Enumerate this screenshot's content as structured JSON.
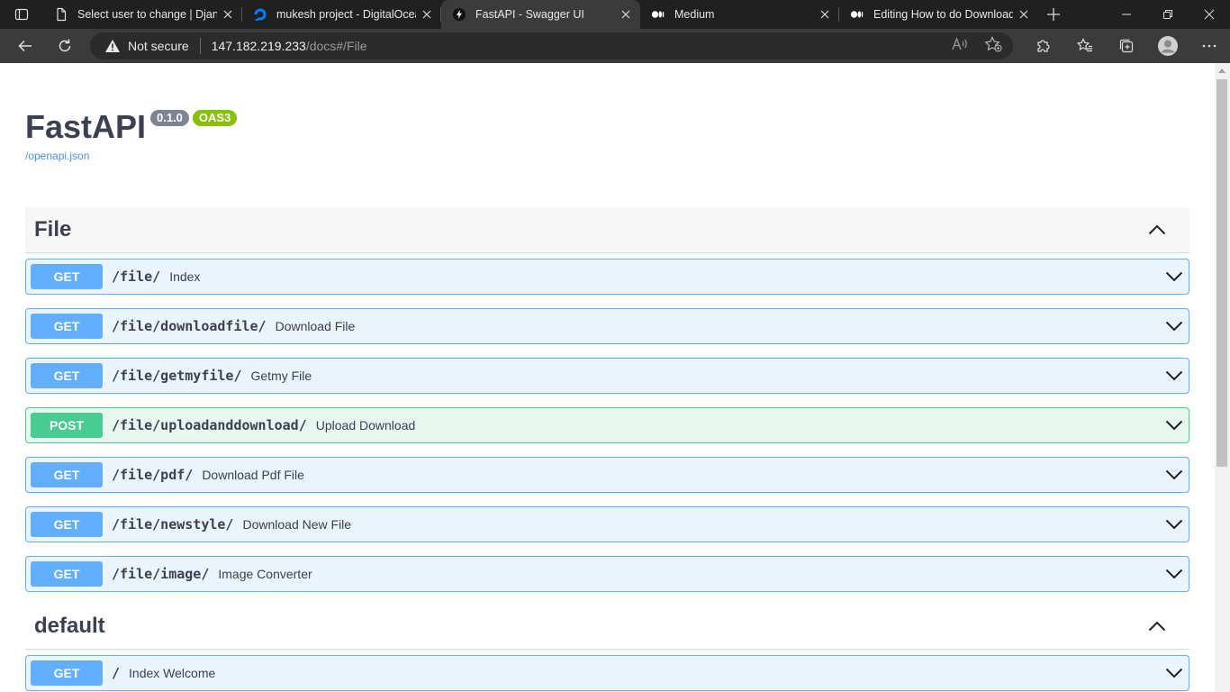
{
  "browser": {
    "tabs": [
      {
        "title": "Select user to change | Django site admin",
        "icon": "page-icon"
      },
      {
        "title": "mukesh project - DigitalOcean",
        "icon": "digitalocean-icon"
      },
      {
        "title": "FastAPI - Swagger UI",
        "icon": "fastapi-icon",
        "active": true
      },
      {
        "title": "Medium",
        "icon": "medium-icon"
      },
      {
        "title": "Editing How to do Download File",
        "icon": "medium-icon"
      }
    ],
    "address": {
      "security": "Not secure",
      "host": "147.182.219.233",
      "path": "/docs#/File"
    }
  },
  "page": {
    "title": "FastAPI",
    "version_badge": "0.1.0",
    "oas_badge": "OAS3",
    "spec_link": "/openapi.json",
    "sections": [
      {
        "name": "File",
        "operations": [
          {
            "method": "GET",
            "path": "/file/",
            "summary": "Index"
          },
          {
            "method": "GET",
            "path": "/file/downloadfile/",
            "summary": "Download File"
          },
          {
            "method": "GET",
            "path": "/file/getmyfile/",
            "summary": "Getmy File"
          },
          {
            "method": "POST",
            "path": "/file/uploadanddownload/",
            "summary": "Upload Download"
          },
          {
            "method": "GET",
            "path": "/file/pdf/",
            "summary": "Download Pdf File"
          },
          {
            "method": "GET",
            "path": "/file/newstyle/",
            "summary": "Download New File"
          },
          {
            "method": "GET",
            "path": "/file/image/",
            "summary": "Image Converter"
          }
        ]
      },
      {
        "name": "default",
        "operations": [
          {
            "method": "GET",
            "path": "/",
            "summary": "Index Welcome"
          }
        ]
      }
    ]
  },
  "colors": {
    "get": "#61affe",
    "post": "#49cc90",
    "oas": "#89bf04",
    "version": "#7d8492",
    "text": "#3b4151"
  }
}
